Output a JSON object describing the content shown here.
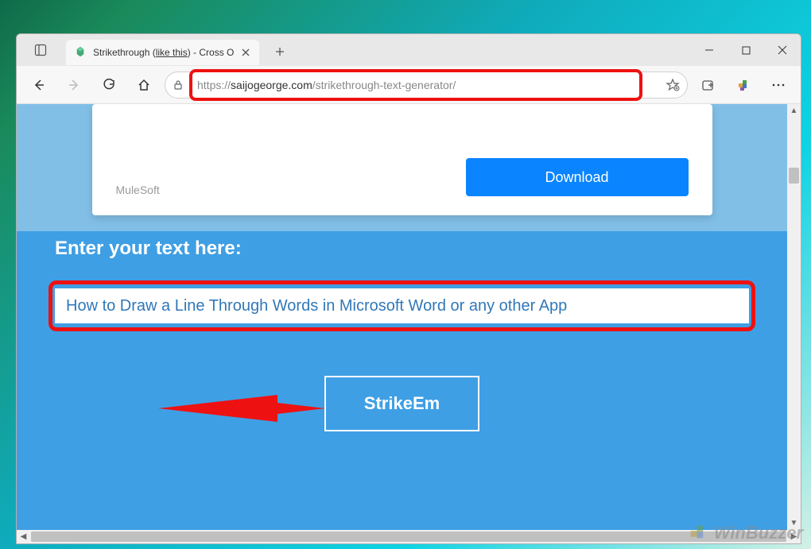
{
  "browser": {
    "tab": {
      "title_prefix": "Strikethrough (",
      "title_underlined": "like this",
      "title_suffix": ") - Cross O"
    },
    "url": {
      "scheme": "https://",
      "host": "saijogeorge.com",
      "path": "/strikethrough-text-generator/"
    }
  },
  "page": {
    "ad": {
      "brand": "MuleSoft",
      "cta": "Download"
    },
    "prompt_label": "Enter your text here:",
    "input_value": "How to Draw a Line Through Words in Microsoft Word or any other App",
    "button_label": "StrikeEm"
  },
  "watermark": {
    "text": "WinBuzzer"
  }
}
